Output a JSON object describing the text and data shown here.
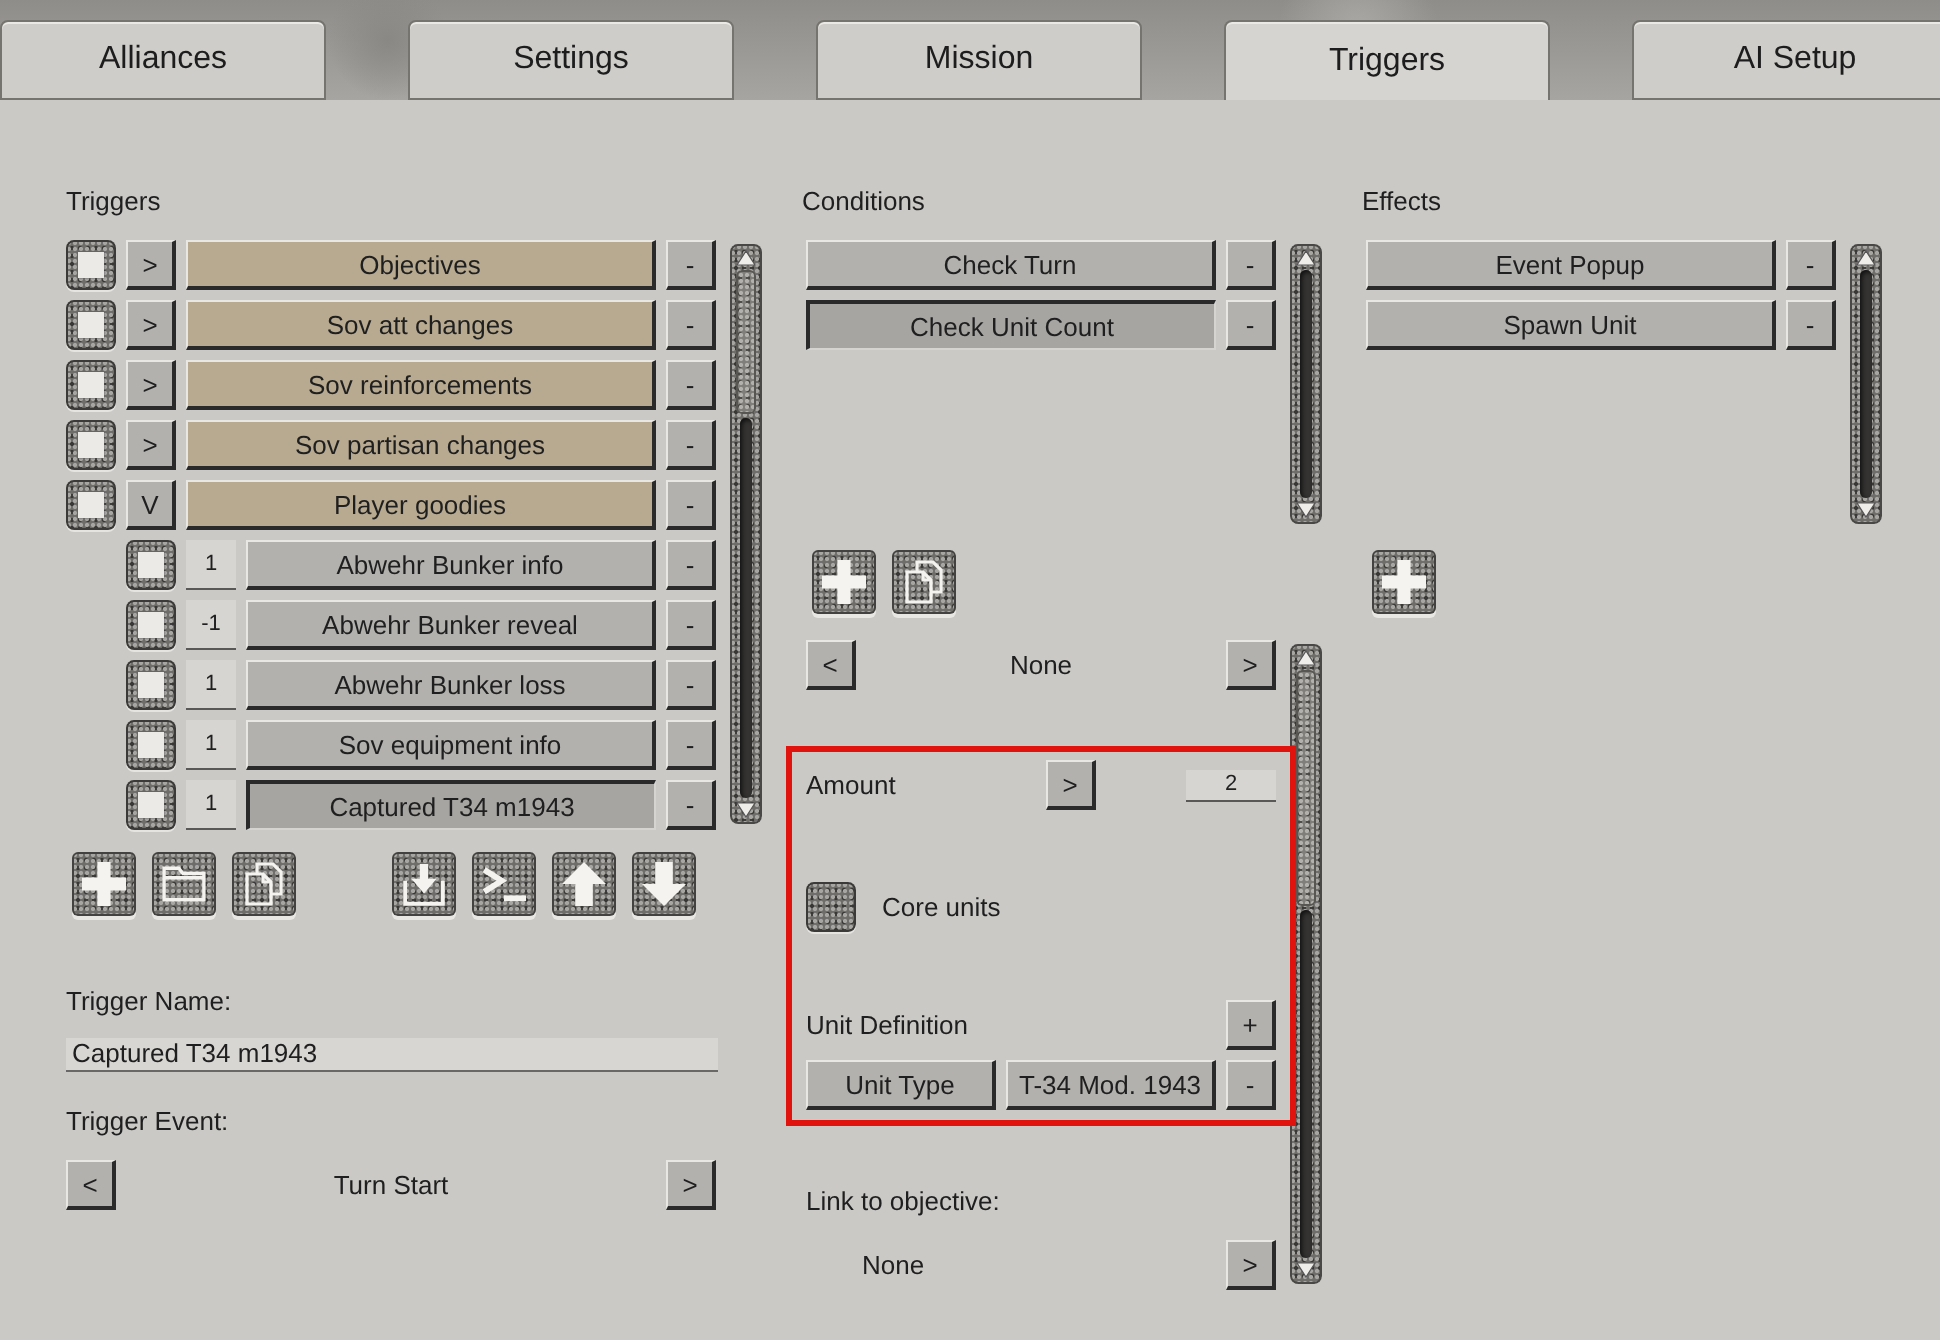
{
  "tabs": [
    {
      "label": "Alliances",
      "selected": false
    },
    {
      "label": "Settings",
      "selected": false
    },
    {
      "label": "Mission",
      "selected": false
    },
    {
      "label": "Triggers",
      "selected": true
    },
    {
      "label": "AI Setup",
      "selected": false
    }
  ],
  "triggers": {
    "title": "Triggers",
    "items": [
      {
        "checked": true,
        "toggle": ">",
        "name": "Objectives",
        "selected": false,
        "remove": "-"
      },
      {
        "checked": true,
        "toggle": ">",
        "name": "Sov att changes",
        "selected": false,
        "remove": "-"
      },
      {
        "checked": true,
        "toggle": ">",
        "name": "Sov reinforcements",
        "selected": false,
        "remove": "-"
      },
      {
        "checked": true,
        "toggle": ">",
        "name": "Sov partisan changes",
        "selected": false,
        "remove": "-"
      },
      {
        "checked": true,
        "toggle": "V",
        "name": "Player goodies",
        "selected": false,
        "remove": "-",
        "children": [
          {
            "checked": true,
            "order": "1",
            "name": "Abwehr Bunker info",
            "selected": false,
            "remove": "-"
          },
          {
            "checked": true,
            "order": "-1",
            "name": "Abwehr Bunker reveal",
            "selected": false,
            "remove": "-"
          },
          {
            "checked": true,
            "order": "1",
            "name": "Abwehr Bunker loss",
            "selected": false,
            "remove": "-"
          },
          {
            "checked": true,
            "order": "1",
            "name": "Sov equipment info",
            "selected": false,
            "remove": "-"
          },
          {
            "checked": true,
            "order": "1",
            "name": "Captured T34 m1943",
            "selected": true,
            "remove": "-"
          }
        ]
      }
    ]
  },
  "trigger_name": {
    "label": "Trigger Name:",
    "value": "Captured T34 m1943"
  },
  "trigger_event": {
    "label": "Trigger Event:",
    "prev": "<",
    "value": "Turn Start",
    "next": ">"
  },
  "conditions": {
    "title": "Conditions",
    "items": [
      {
        "name": "Check Turn",
        "selected": false,
        "remove": "-"
      },
      {
        "name": "Check Unit Count",
        "selected": true,
        "remove": "-"
      }
    ],
    "selector": {
      "prev": "<",
      "value": "None",
      "next": ">"
    },
    "details": {
      "highlighted": true,
      "amount": {
        "label": "Amount",
        "button": ">",
        "value": "2"
      },
      "core_units": {
        "label": "Core units",
        "checked": false
      },
      "unit_definition": {
        "label": "Unit Definition",
        "add": "+",
        "rows": [
          {
            "type": "Unit Type",
            "value": "T-34 Mod. 1943",
            "remove": "-"
          }
        ]
      },
      "link": {
        "label": "Link to objective:",
        "value": "None",
        "next": ">"
      }
    }
  },
  "effects": {
    "title": "Effects",
    "items": [
      {
        "name": "Event Popup",
        "selected": false,
        "remove": "-"
      },
      {
        "name": "Spawn Unit",
        "selected": false,
        "remove": "-"
      }
    ]
  }
}
